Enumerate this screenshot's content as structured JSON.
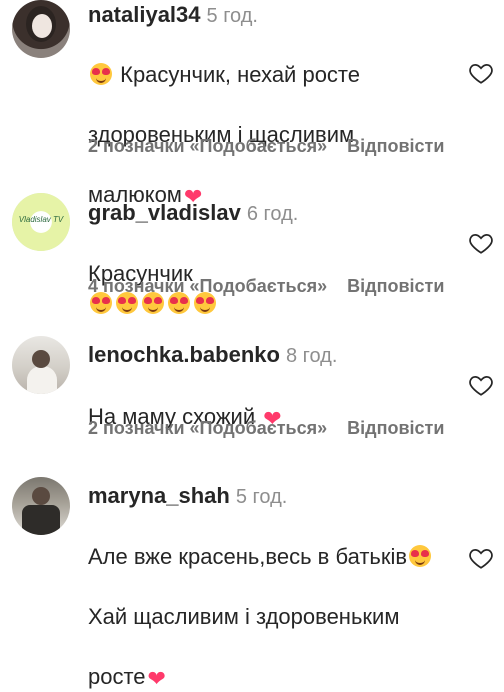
{
  "comments": [
    {
      "username": "nataliyal34",
      "time": "5 год.",
      "line1": "Красунчик, нехай росте",
      "line2": "здоровеньким і щасливим",
      "line3": "малюком",
      "likes": "2 позначки «Подобається»",
      "reply": "Відповісти"
    },
    {
      "username": "grab_vladislav",
      "time": "6 год.",
      "line1": "Красунчик",
      "avatar_text": "Vladislav TV",
      "likes": "4 позначки «Подобається»",
      "reply": "Відповісти"
    },
    {
      "username": "lenochka.babenko",
      "time": "8 год.",
      "line1": "На маму схожий",
      "likes": "2 позначки «Подобається»",
      "reply": "Відповісти"
    },
    {
      "username": "maryna_shah",
      "time": "5 год.",
      "line1": "Але вже красень,весь в батьків",
      "line2": "Хай щасливим і здоровеньким",
      "line3": "росте"
    }
  ],
  "icons": {
    "emoji": "smiling-face-with-heart-eyes",
    "heart_emoji": "red-heart",
    "like": "heart-outline-icon"
  },
  "colors": {
    "text": "#262626",
    "secondary": "#737373",
    "heart": "#ff3a6b"
  }
}
